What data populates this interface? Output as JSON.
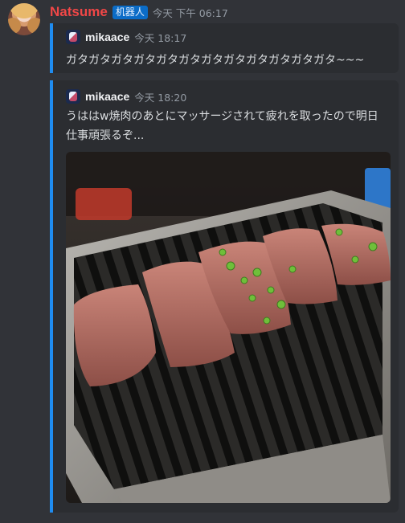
{
  "message": {
    "author": "Natsume",
    "badge": "机器人",
    "timestamp": "今天 下午 06:17",
    "author_color": "#f04747",
    "accent_color": "#1f8cf0",
    "avatar_icon": "anime-girl-avatar"
  },
  "quotes": [
    {
      "author": "mikaace",
      "time": "今天 18:17",
      "avatar_icon": "mikaace-avatar",
      "text": "ガタガタガタガタガタガタガタガタガタガタガタガタ~~~"
    },
    {
      "author": "mikaace",
      "time": "今天 18:20",
      "avatar_icon": "mikaace-avatar",
      "text": "うははw焼肉のあとにマッサージされて疲れを取ったので明日仕事頑張るぞ...",
      "image": "yakiniku-grill-photo"
    }
  ]
}
